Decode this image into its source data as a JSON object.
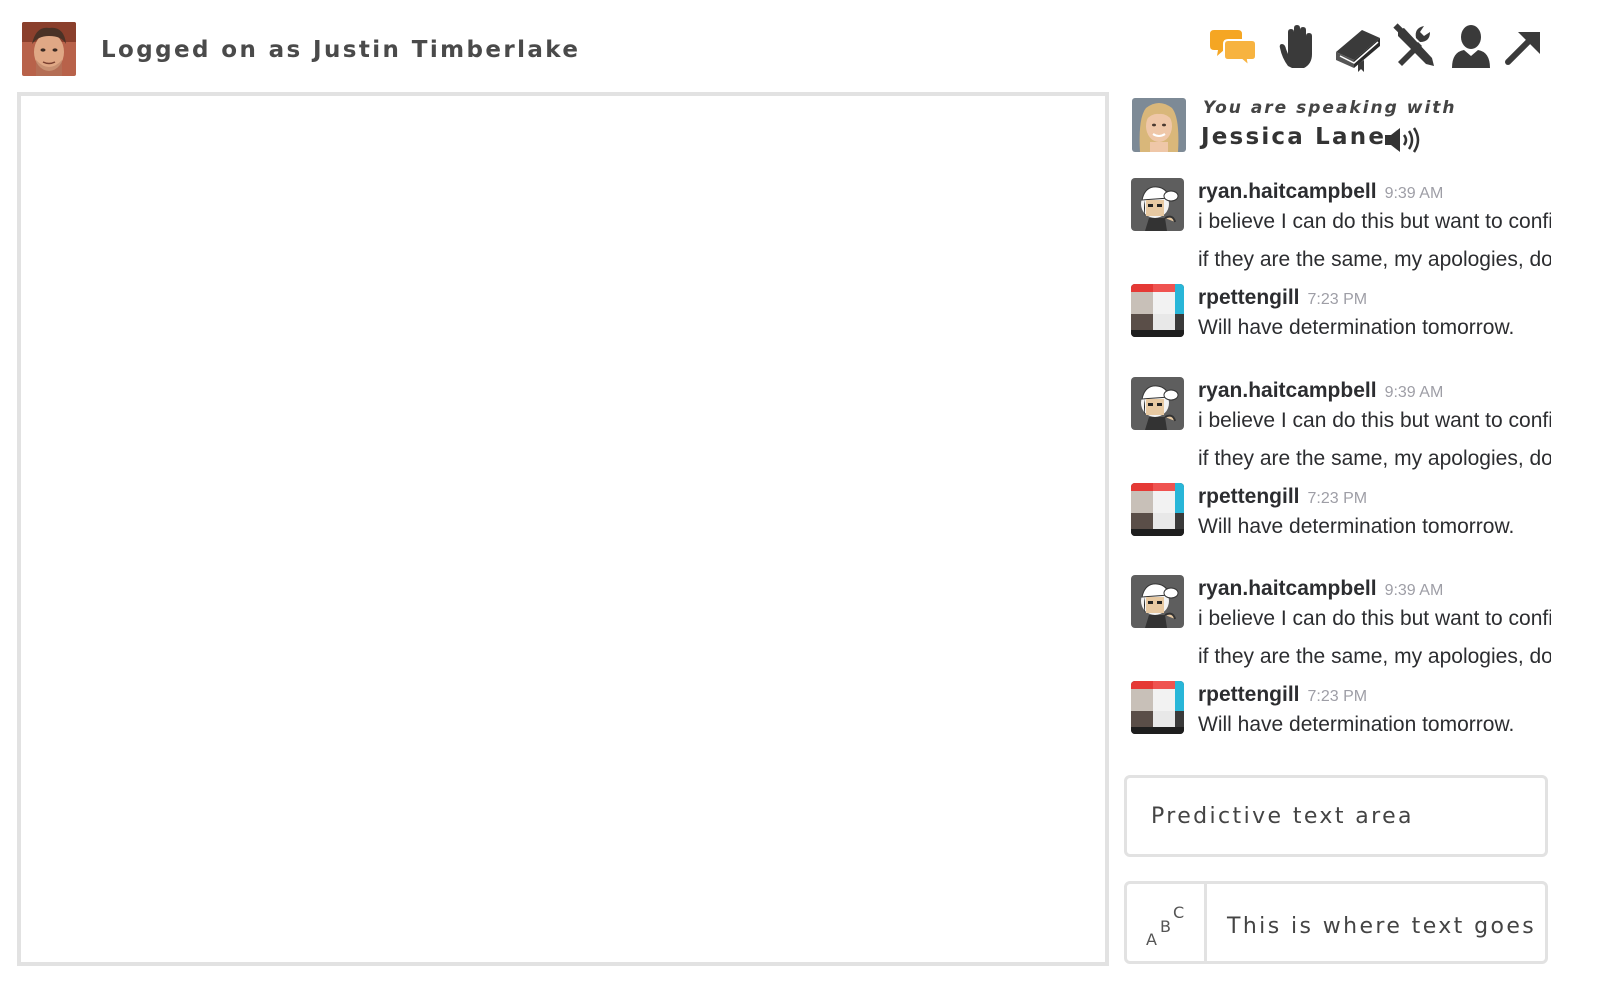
{
  "header": {
    "logged_in_label": "Logged on as Justin Timberlake",
    "toolbar": [
      {
        "icon": "speech-bubbles-icon",
        "color": "#f5a623"
      },
      {
        "icon": "hand-icon",
        "color": "#3a3a3a"
      },
      {
        "icon": "book-icon",
        "color": "#3a3a3a"
      },
      {
        "icon": "tools-icon",
        "color": "#3a3a3a"
      },
      {
        "icon": "user-icon",
        "color": "#3a3a3a"
      },
      {
        "icon": "arrow-up-right-icon",
        "color": "#3a3a3a"
      }
    ]
  },
  "chat": {
    "speaking_with_label": "You are speaking with",
    "contact_name": "Jessica Lane",
    "messages": [
      {
        "author": "ryan.haitcampbell",
        "time": "9:39 AM",
        "line1": "i believe I can do this but want to confirm",
        "line2": "if they are the same, my apologies, don't"
      },
      {
        "author": "rpettengill",
        "time": "7:23 PM",
        "line1": "Will have determination tomorrow."
      },
      {
        "author": "ryan.haitcampbell",
        "time": "9:39 AM",
        "line1": "i believe I can do this but want to confirm",
        "line2": "if they are the same, my apologies, don't"
      },
      {
        "author": "rpettengill",
        "time": "7:23 PM",
        "line1": "Will have determination tomorrow."
      },
      {
        "author": "ryan.haitcampbell",
        "time": "9:39 AM",
        "line1": "i believe I can do this but want to confirm",
        "line2": "if they are the same, my apologies, don't"
      },
      {
        "author": "rpettengill",
        "time": "7:23 PM",
        "line1": "Will have determination tomorrow."
      }
    ],
    "predictive_text": "Predictive text area",
    "input_text": "This is where text goes",
    "abc_letters": {
      "a": "A",
      "b": "B",
      "c": "C"
    }
  },
  "colors": {
    "accent_orange": "#f5a623",
    "border_gray": "#e2e2e2",
    "timestamp_gray": "#9e9ea6"
  }
}
